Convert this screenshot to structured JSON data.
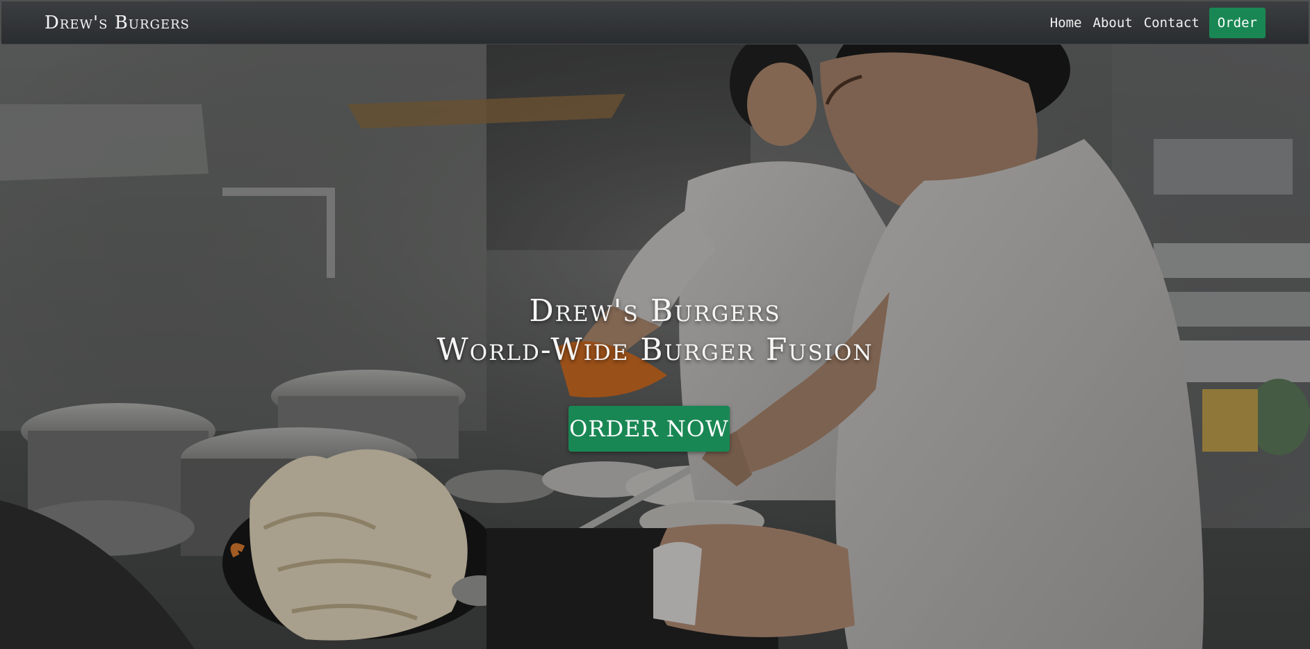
{
  "navbar": {
    "brand": "Drew's Burgers",
    "links": [
      {
        "label": "Home"
      },
      {
        "label": "About"
      },
      {
        "label": "Contact"
      }
    ],
    "order_label": "Order"
  },
  "hero": {
    "title_line1": "Drew's Burgers",
    "title_line2": "World-Wide Burger Fusion",
    "cta_label": "ORDER NOW"
  },
  "colors": {
    "accent": "#198754",
    "navbar": "#2f3235"
  }
}
